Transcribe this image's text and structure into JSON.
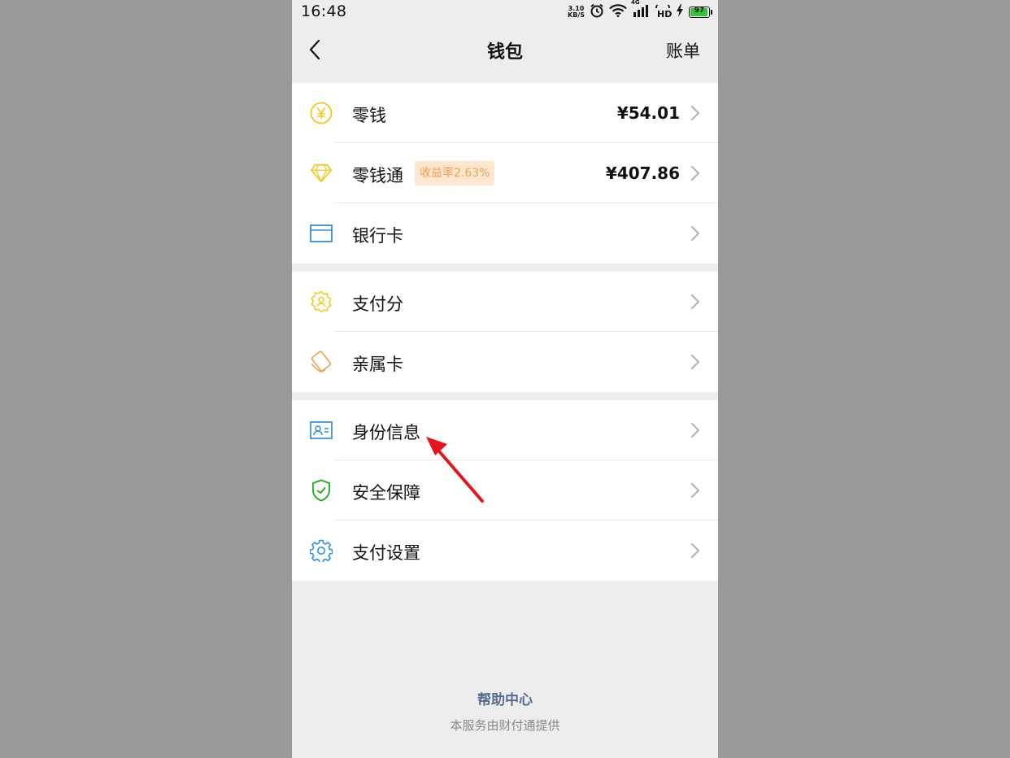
{
  "status_bar": {
    "time": "16:48",
    "net_speed_value": "3.10",
    "net_speed_unit": "KB/S",
    "network_type": "4G",
    "hd_label": "HD",
    "battery_level": "97"
  },
  "navbar": {
    "title": "钱包",
    "right_action": "账单"
  },
  "groups": [
    {
      "items": [
        {
          "label": "零钱",
          "value": "¥54.01",
          "icon": "coin-yen-icon",
          "color": "#f5c518"
        },
        {
          "label": "零钱通",
          "badge": "收益率2.63%",
          "value": "¥407.86",
          "icon": "diamond-icon",
          "color": "#f5c518"
        },
        {
          "label": "银行卡",
          "icon": "bank-card-icon",
          "color": "#2f8fd8"
        }
      ]
    },
    {
      "items": [
        {
          "label": "支付分",
          "icon": "pay-score-icon",
          "color": "#f5c518"
        },
        {
          "label": "亲属卡",
          "icon": "family-card-icon",
          "color": "#f0a04f"
        }
      ]
    },
    {
      "items": [
        {
          "label": "身份信息",
          "icon": "id-card-icon",
          "color": "#2f8fd8"
        },
        {
          "label": "安全保障",
          "icon": "shield-icon",
          "color": "#1aad19"
        },
        {
          "label": "支付设置",
          "icon": "gear-icon",
          "color": "#2f8fd8"
        }
      ]
    }
  ],
  "footer": {
    "help_center": "帮助中心",
    "provider_note": "本服务由财付通提供"
  },
  "colors": {
    "background": "#ededed",
    "link": "#576b95",
    "annotation_arrow": "#e8141b"
  }
}
